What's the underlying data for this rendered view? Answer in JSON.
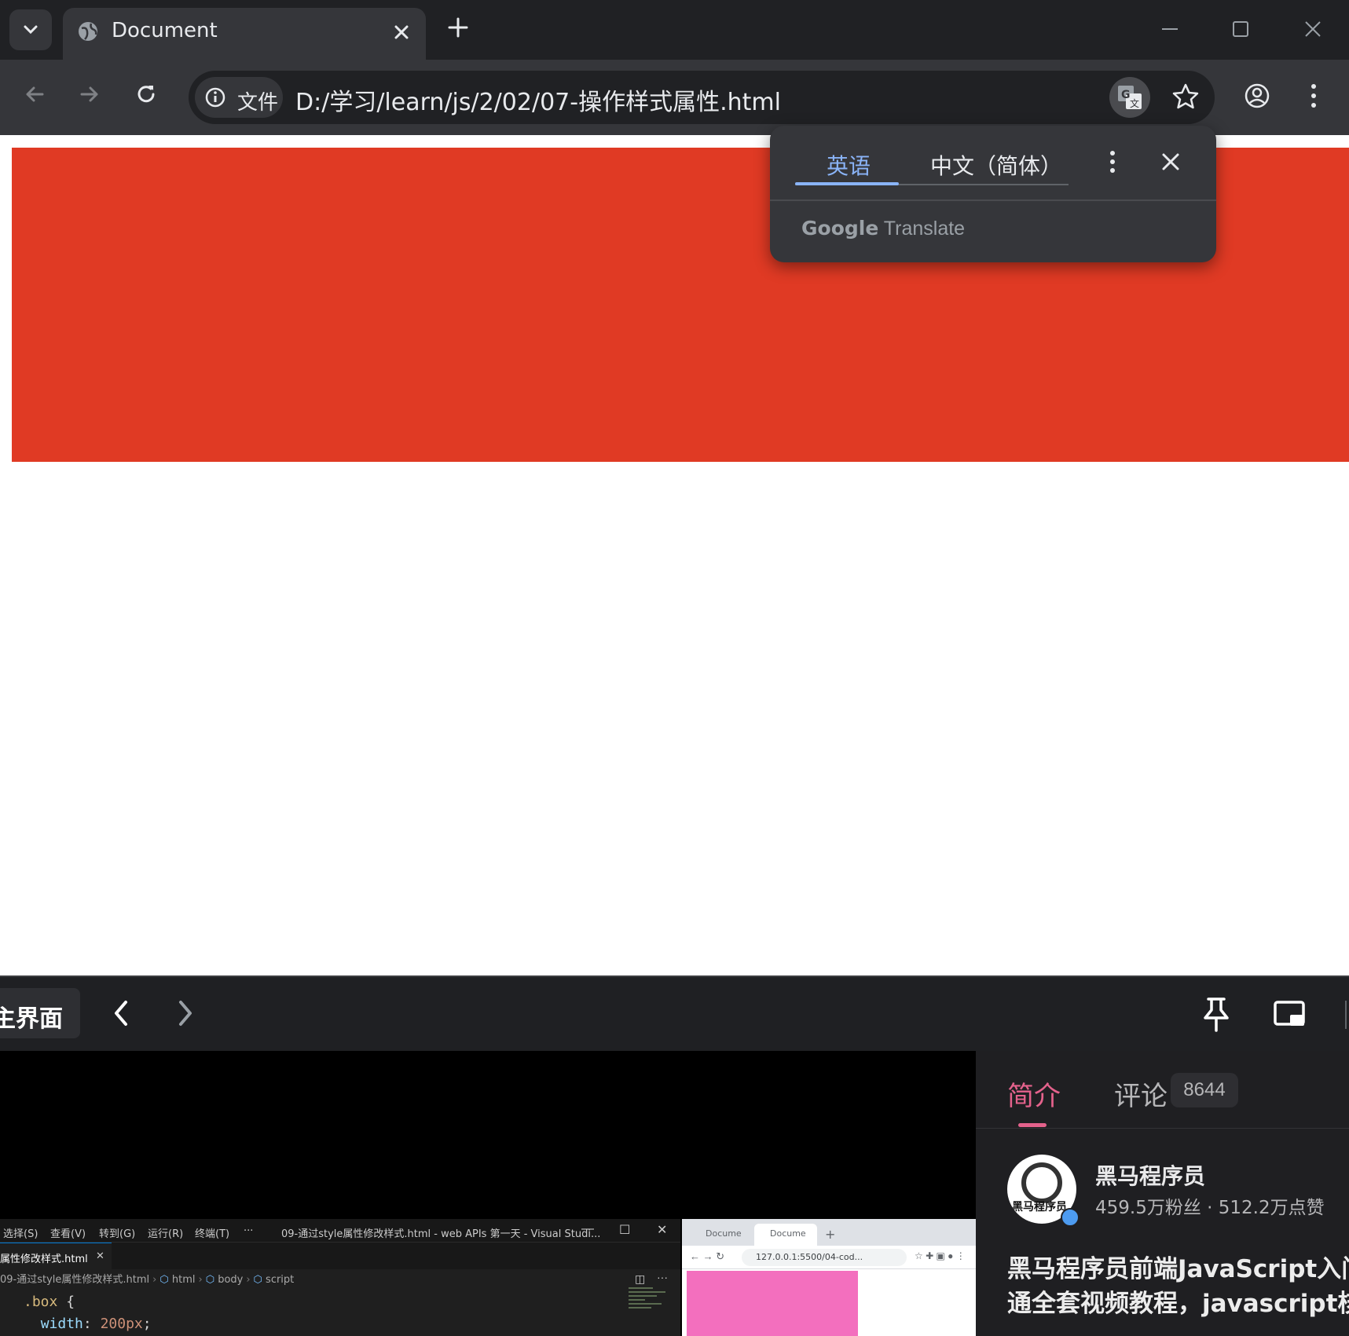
{
  "browser": {
    "tab": {
      "title": "Document"
    },
    "omnibox": {
      "chip_label": "文件",
      "url": "D:/学习/learn/js/2/02/07-操作样式属性.html"
    }
  },
  "page": {
    "box_color": "#e03a24"
  },
  "translate_popup": {
    "tabs": [
      "英语",
      "中文（简体）"
    ],
    "active_tab": 0,
    "brand_google": "Google",
    "brand_translate": "Translate"
  },
  "overlay": {
    "home_label": "主界面",
    "video": {
      "vscode": {
        "menu": [
          "选择(S)",
          "查看(V)",
          "转到(G)",
          "运行(R)",
          "终端(T)",
          "···"
        ],
        "window_title": "09-通过style属性修改样式.html - web APIs 第一天 - Visual Studi...",
        "tab_label": "属性修改样式.html",
        "breadcrumbs": [
          "09-通过style属性修改样式.html",
          "html",
          "body",
          "script"
        ],
        "code": {
          "line1_selector": ".box",
          "line1_brace": " {",
          "line2_prop": "width",
          "line2_sep": ": ",
          "line2_num": "200px",
          "line2_end": ";"
        }
      },
      "mini_browser": {
        "tabs": [
          "Docume",
          "Docume"
        ],
        "url": "127.0.0.1:5500/04-cod...",
        "box_color": "#f36fbe"
      }
    },
    "side": {
      "tabs": {
        "intro": "简介",
        "comments": "评论",
        "comment_count": "8644"
      },
      "avatar_text": "黑马程序员",
      "author": "黑马程序员",
      "stats": "459.5万粉丝 · 512.2万点赞",
      "description": [
        "黑马程序员前端JavaScript入门",
        "通全套视频教程，javascript核心"
      ]
    }
  }
}
